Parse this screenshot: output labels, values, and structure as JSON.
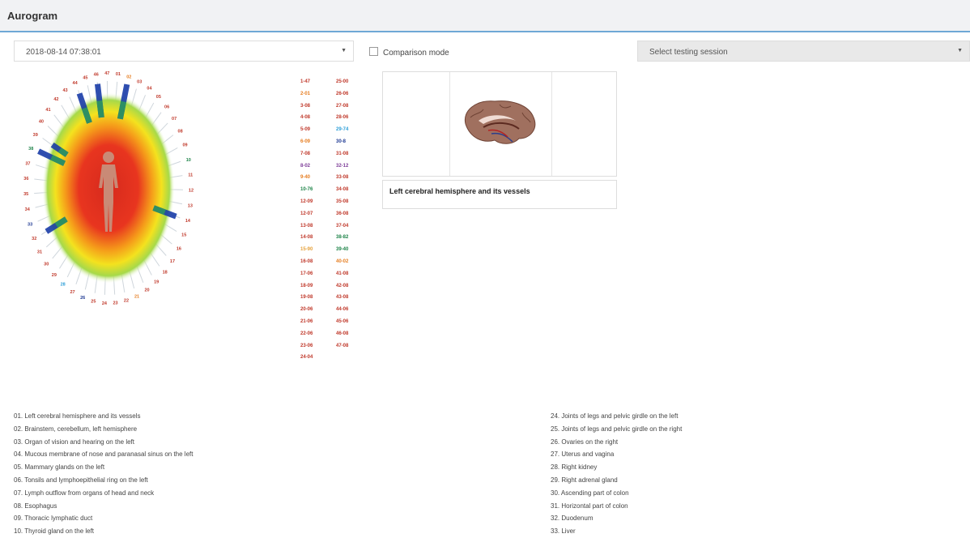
{
  "header": {
    "title": "Aurogram"
  },
  "date_select": {
    "value": "2018-08-14 07:38:01"
  },
  "comparison": {
    "label": "Comparison mode",
    "checked": false
  },
  "session_select": {
    "placeholder": "Select testing session"
  },
  "aurogram": {
    "ring_numbers": [
      "01",
      "02",
      "03",
      "04",
      "05",
      "06",
      "07",
      "08",
      "09",
      "10",
      "11",
      "12",
      "13",
      "14",
      "15",
      "16",
      "17",
      "18",
      "19",
      "20",
      "21",
      "22",
      "23",
      "24",
      "25",
      "26",
      "27",
      "28",
      "29",
      "30",
      "31",
      "32",
      "33",
      "34",
      "35",
      "36",
      "37",
      "38",
      "39",
      "40",
      "41",
      "42",
      "43",
      "44",
      "45",
      "46",
      "47"
    ],
    "ring_colors": {
      "default": "#c0392b",
      "orange": "#e67e22",
      "green": "#1e8449",
      "navy": "#1f3a93",
      "cyan": "#2e9fd8"
    }
  },
  "pairs": {
    "col1": [
      "1-47",
      "2-01",
      "3-08",
      "4-08",
      "5-09",
      "6-09",
      "7-08",
      "8-02",
      "9-40",
      "10-76",
      "12-09",
      "12-07",
      "13-08",
      "14-08",
      "15-90",
      "16-08",
      "17-06",
      "18-09",
      "19-08",
      "20-06",
      "21-06",
      "22-06",
      "23-06",
      "24-04"
    ],
    "col2": [
      "25-00",
      "26-06",
      "27-08",
      "28-06",
      "29-74",
      "30-8",
      "31-08",
      "32-12",
      "33-08",
      "34-08",
      "35-08",
      "36-08",
      "37-04",
      "38-82",
      "39-40",
      "40-02",
      "41-08",
      "42-08",
      "43-08",
      "44-06",
      "45-06",
      "46-08",
      "47-08"
    ],
    "col1_colors": [
      "#c0392b",
      "#e67e22",
      "#c0392b",
      "#c0392b",
      "#c0392b",
      "#e67e22",
      "#c0392b",
      "#7d3c98",
      "#e67e22",
      "#1e8449",
      "#c0392b",
      "#c0392b",
      "#c0392b",
      "#c0392b",
      "#e6a23c",
      "#c0392b",
      "#c0392b",
      "#c0392b",
      "#c0392b",
      "#c0392b",
      "#c0392b",
      "#c0392b",
      "#c0392b",
      "#c0392b"
    ],
    "col2_colors": [
      "#c0392b",
      "#c0392b",
      "#c0392b",
      "#c0392b",
      "#2e9fd8",
      "#1f3a93",
      "#c0392b",
      "#7d3c98",
      "#c0392b",
      "#c0392b",
      "#c0392b",
      "#c0392b",
      "#c0392b",
      "#1e8449",
      "#1e8449",
      "#e67e22",
      "#c0392b",
      "#c0392b",
      "#c0392b",
      "#c0392b",
      "#c0392b",
      "#c0392b",
      "#c0392b"
    ]
  },
  "organ": {
    "caption": "Left cerebral hemisphere and its vessels",
    "image_icon": "brain-icon"
  },
  "legend": {
    "left": [
      "01. Left cerebral hemisphere and its vessels",
      "02. Brainstem, cerebellum, left hemisphere",
      "03. Organ of vision and hearing on the left",
      "04. Mucous membrane of nose and paranasal sinus on the left",
      "05. Mammary glands on the left",
      "06. Tonsils and lymphoepithelial ring on the left",
      "07. Lymph outflow from organs of head and neck",
      "08. Esophagus",
      "09. Thoracic lymphatic duct",
      "10. Thyroid gland on the left"
    ],
    "right": [
      "24. Joints of legs and pelvic girdle on the left",
      "25. Joints of legs and pelvic girdle on the right",
      "26. Ovaries on the right",
      "27. Uterus and vagina",
      "28. Right kidney",
      "29. Right adrenal gland",
      "30. Ascending part of colon",
      "31. Horizontal part of colon",
      "32. Duodenum",
      "33. Liver"
    ]
  }
}
